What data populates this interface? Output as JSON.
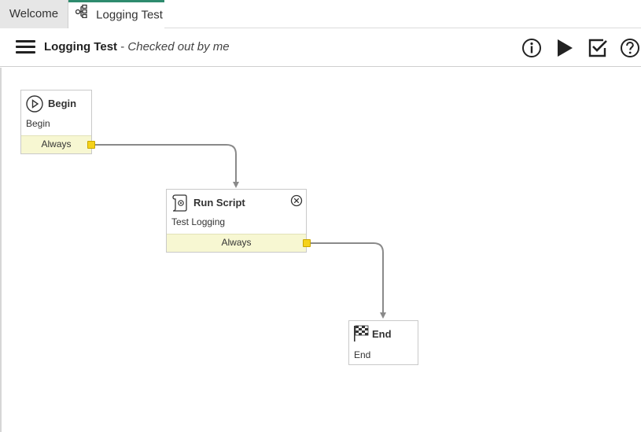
{
  "tabs": {
    "welcome": "Welcome",
    "active": "Logging Test"
  },
  "header": {
    "workflow_name": "Logging Test",
    "separator": " - ",
    "status": "Checked out by me"
  },
  "toolbar": {
    "info_icon": "info-icon",
    "run_icon": "play-icon",
    "validate_icon": "checkbox-icon",
    "help_icon": "help-icon"
  },
  "nodes": {
    "begin": {
      "title": "Begin",
      "subtitle": "Begin",
      "condition": "Always",
      "icon": "play-circle-icon"
    },
    "run_script": {
      "title": "Run Script",
      "subtitle": "Test Logging",
      "condition": "Always",
      "icon": "script-icon"
    },
    "end": {
      "title": "End",
      "subtitle": "End",
      "icon": "checkered-flag-icon"
    }
  },
  "colors": {
    "accent": "#2e8b6e",
    "condition_bg": "#f7f7d2",
    "port": "#f5d21b",
    "edge": "#8a8a8a"
  }
}
